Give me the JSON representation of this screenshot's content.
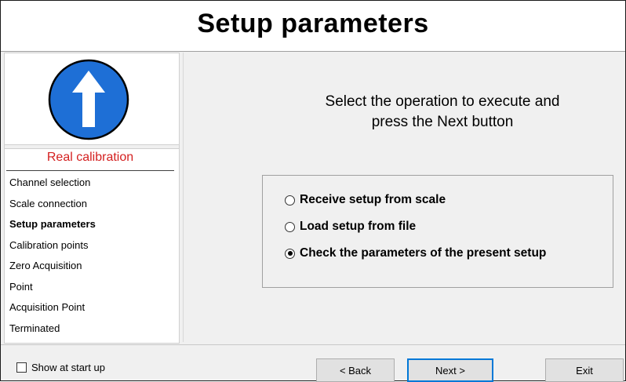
{
  "header": {
    "title": "Setup parameters"
  },
  "sidebar": {
    "section_title": "Real calibration",
    "steps": [
      "Channel selection",
      "Scale connection",
      "Setup parameters",
      "Calibration points",
      "Zero Acquisition",
      "Point",
      "Acquisition Point",
      "Terminated"
    ],
    "active_step": "Setup parameters"
  },
  "main": {
    "instruction_line1": "Select the operation to execute and",
    "instruction_line2": "press the Next button",
    "options": [
      {
        "label": "Receive setup from scale",
        "selected": false
      },
      {
        "label": "Load setup from file",
        "selected": false
      },
      {
        "label": "Check the parameters of the present setup",
        "selected": true
      }
    ]
  },
  "footer": {
    "show_at_startup_label": "Show at start up",
    "show_at_startup_checked": false,
    "back_label": "< Back",
    "next_label": "Next >",
    "exit_label": "Exit"
  },
  "colors": {
    "accent_red": "#d42020",
    "icon_blue": "#1e6fd6",
    "focus_blue": "#0078d7"
  },
  "icons": {
    "step_icon": "arrow-up-circle-icon"
  }
}
